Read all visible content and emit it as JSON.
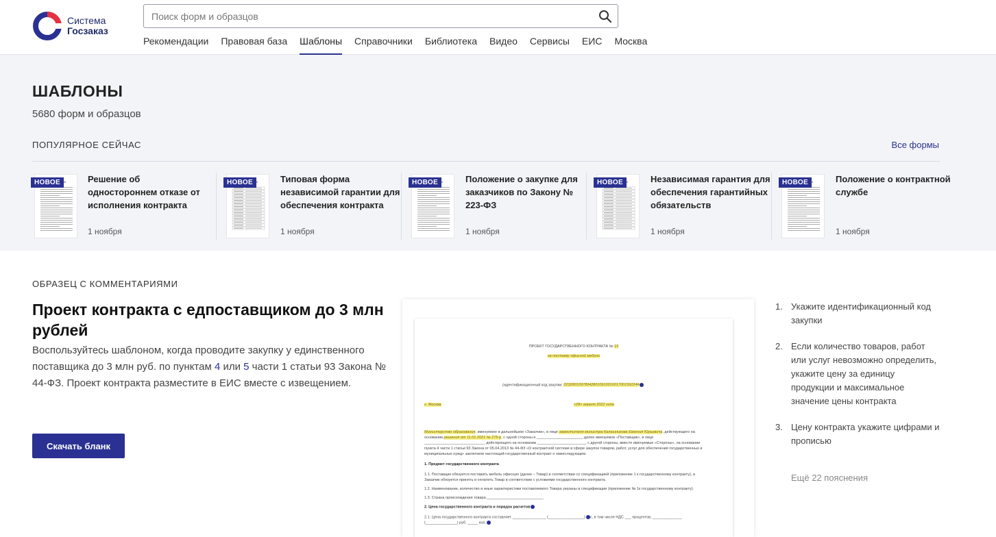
{
  "header": {
    "logo_line1": "Система",
    "logo_line2": "Госзаказ",
    "search_placeholder": "Поиск форм и образцов",
    "nav": [
      "Рекомендации",
      "Правовая база",
      "Шаблоны",
      "Справочники",
      "Библиотека",
      "Видео",
      "Сервисы",
      "ЕИС",
      "Москва"
    ],
    "nav_active": "Шаблоны"
  },
  "templates": {
    "title": "ШАБЛОНЫ",
    "count": "5680 форм и образцов",
    "popular_label": "ПОПУЛЯРНОЕ СЕЙЧАС",
    "all_forms": "Все формы",
    "cards": [
      {
        "badge": "НОВОЕ",
        "title": "Решение об одностороннем отказе от исполнения контракта",
        "date": "1 ноября"
      },
      {
        "badge": "НОВОЕ",
        "title": "Типовая форма независимой гарантии для обеспечения контракта",
        "date": "1 ноября"
      },
      {
        "badge": "НОВОЕ",
        "title": "Положение о закупке для заказчиков по Закону № 223-ФЗ",
        "date": "1 ноября"
      },
      {
        "badge": "НОВОЕ",
        "title": "Независимая гарантия для обеспечения гарантийных обязательств",
        "date": "1 ноября"
      },
      {
        "badge": "НОВОЕ",
        "title": "Положение о контрактной службе",
        "date": "1 ноября"
      }
    ]
  },
  "sample": {
    "label": "ОБРАЗЕЦ С КОММЕНТАРИЯМИ",
    "title": "Проект контракта с едпоставщиком до 3 млн рублей",
    "desc_part1": "Воспользуйтесь шаблоном, когда проводите закупку у единственного поставщика до 3 млн руб. по пунктам ",
    "desc_link1": "4",
    "desc_part2": " или ",
    "desc_link2": "5",
    "desc_part3": " части 1 статьи 93 Закона № 44-ФЗ. Проект контракта разместите в ЕИС вместе с извещением.",
    "download": "Скачать бланк",
    "doc": {
      "heading": "ПРОЕКТ ГОСУДАРСТВЕННОГО КОНТРАКТА №",
      "heading_num": "15",
      "subheading": "на поставку офисной мебели",
      "ikz_label": "(идентификационный код закупки:",
      "ikz_value": "223280109789428010910010017001592244",
      "city": "г. Москва",
      "date_label": "«28» апреля 2022 года",
      "p1_mark1": "Министерство образования",
      "p1_text1": ", именуемое в дальнейшем «Заказчик», в лице ",
      "p1_mark2": "заместителя министра Калашникова Евгения Юрьевича",
      "p1_text2": ", действующего на",
      "p2_text1": "основании ",
      "p2_mark": "решения от 11.01.2021 № 275-р",
      "p2_text2": ", с одной стороны и ______________________ далее именуемое «Поставщик», в лице",
      "p3": "_____________________________ действующего на основании _______________________, с другой стороны, вместе именуемые «Стороны», на основании",
      "p4": "пункта 4 части 1 статьи 93 Закона от 05.04.2013 № 44-ФЗ «О контрактной системе в сфере закупок товаров, работ, услуг для обеспечения государственных и",
      "p5": "муниципальных нужд» заключили настоящий государственный контракт о нижеследующем.",
      "s1": "1. Предмет государственного контракта",
      "s1_1": "1.1. Поставщик обязуется поставить мебель офисную (далее – Товар) в соответствии со спецификацией (приложение 1 к государственному контракту), а",
      "s1_1b": "Заказчик обязуется принять и оплатить Товар в соответствии с условиями государственного контракта.",
      "s1_2": "1.2. Наименование, количество и иные характеристики поставляемого Товара указаны в спецификации (приложение № 1к государственному контракту).",
      "s1_3": "1.3. Страна происхождения товара ___________________________",
      "s2": "2. Цена государственного контракта и порядок расчетов",
      "s2_1": "2.1. Цена государственного контракта составляет ________________ (_________________)",
      "s2_1b": "с, в том числе НДС ___ процентов, ______________",
      "s2_1c": "(_______________) руб. _____ коп."
    },
    "notes": [
      {
        "num": "1.",
        "text": "Укажите идентификационный код закупки"
      },
      {
        "num": "2.",
        "text": "Если количество товаров, работ или услуг невозможно определить, укажите цену за единицу продукции и максимальное значение цены контракта"
      },
      {
        "num": "3.",
        "text": "Цену контракта укажите цифрами и прописью"
      }
    ],
    "more_notes": "Ещё 22 пояснения"
  },
  "colors": {
    "brand": "#2a3192",
    "accent_red": "#e63240",
    "bg_section": "#f3f4f8"
  }
}
